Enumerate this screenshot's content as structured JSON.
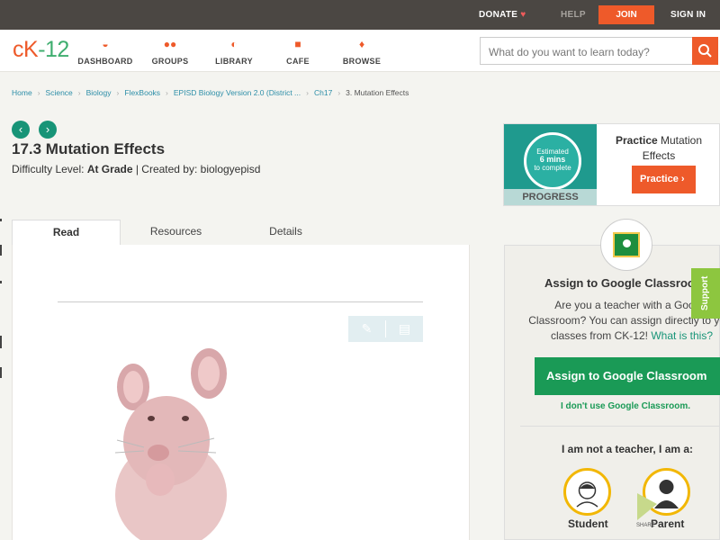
{
  "topbar": {
    "donate": "DONATE",
    "help": "HELP",
    "join": "JOIN",
    "signin": "SIGN IN"
  },
  "header": {
    "logo": "cK-12",
    "nav": [
      {
        "label": "DASHBOARD",
        "icon": "dashboard-icon"
      },
      {
        "label": "GROUPS",
        "icon": "groups-icon"
      },
      {
        "label": "LIBRARY",
        "icon": "library-icon"
      },
      {
        "label": "CAFE",
        "icon": "cafe-icon"
      },
      {
        "label": "BROWSE",
        "icon": "browse-icon"
      }
    ],
    "search_placeholder": "What do you want to learn today?"
  },
  "breadcrumb": [
    "Home",
    "Science",
    "Biology",
    "FlexBooks",
    "EPISD Biology Version 2.0 (District ...",
    "Ch17",
    "3. Mutation Effects"
  ],
  "lesson": {
    "title": "17.3 Mutation Effects",
    "difficulty_label": "Difficulty Level: ",
    "difficulty_value": "At Grade",
    "created_by": " | Created by: biologyepisd"
  },
  "tabs": [
    "Read",
    "Resources",
    "Details"
  ],
  "practice": {
    "estimated": "Estimated",
    "mins": "6 mins",
    "to_complete": "to complete",
    "progress_label": "PROGRESS",
    "title_bold": "Practice",
    "title_rest": " Mutation Effects",
    "button": "Practice"
  },
  "classroom": {
    "title": "Assign to Google Classroom",
    "line1": "Are you a teacher with a Google",
    "line2": "Classroom? You can assign directly to your",
    "line3": "classes from CK-12!",
    "what_link": "What is this?",
    "assign_button": "Assign to Google Classroom",
    "dont_use": "I don't use Google Classroom.",
    "role_question": "I am not a teacher, I am a:",
    "student": "Student",
    "parent": "Parent",
    "support": "Support",
    "share": "SHARE"
  },
  "colors": {
    "accent": "#ee5a2a",
    "teal": "#179477",
    "green": "#1a9a56"
  }
}
